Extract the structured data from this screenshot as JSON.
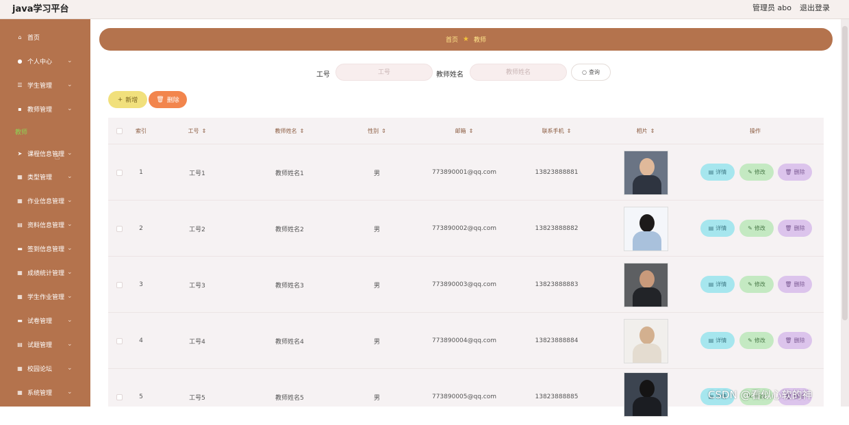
{
  "header": {
    "brand": "java学习平台",
    "admin": "管理员 abo",
    "logout": "退出登录"
  },
  "sidebar": {
    "items": [
      {
        "label": "首页",
        "icon": "home-icon",
        "has_chevron": false
      },
      {
        "label": "个人中心",
        "icon": "user-icon",
        "has_chevron": true
      },
      {
        "label": "学生管理",
        "icon": "list-icon",
        "has_chevron": true
      },
      {
        "label": "教师管理",
        "icon": "list-icon",
        "has_chevron": true
      }
    ],
    "group_label": "教师",
    "group_items": [
      {
        "label": "课程信息管理",
        "icon": "send-icon"
      },
      {
        "label": "类型管理",
        "icon": "grid-icon"
      },
      {
        "label": "作业信息管理",
        "icon": "grid-icon"
      },
      {
        "label": "资料信息管理",
        "icon": "doc-icon"
      },
      {
        "label": "签到信息管理",
        "icon": "list-icon"
      },
      {
        "label": "成绩统计管理",
        "icon": "grid-icon"
      },
      {
        "label": "学生作业管理",
        "icon": "grid-icon"
      },
      {
        "label": "试卷管理",
        "icon": "doc-icon"
      },
      {
        "label": "试题管理",
        "icon": "doc-icon"
      },
      {
        "label": "校园论坛",
        "icon": "grid-icon"
      },
      {
        "label": "系统管理",
        "icon": "grid-icon"
      }
    ]
  },
  "breadcrumb": {
    "home": "首页",
    "current": "教师"
  },
  "search": {
    "id_label": "工号",
    "id_placeholder": "工号",
    "name_label": "教师姓名",
    "name_placeholder": "教师姓名",
    "query_label": "查询"
  },
  "toolbar": {
    "add_label": "新增",
    "delete_label": "删除"
  },
  "table": {
    "columns": [
      "索引",
      "工号",
      "教师姓名",
      "性别",
      "邮箱",
      "联系手机",
      "相片",
      "操作"
    ],
    "actions": {
      "detail": "详情",
      "edit": "修改",
      "delete": "删除"
    },
    "rows": [
      {
        "index": "1",
        "id": "工号1",
        "name": "教师姓名1",
        "gender": "男",
        "email": "773890001@qq.com",
        "phone": "13823888881"
      },
      {
        "index": "2",
        "id": "工号2",
        "name": "教师姓名2",
        "gender": "男",
        "email": "773890002@qq.com",
        "phone": "13823888882"
      },
      {
        "index": "3",
        "id": "工号3",
        "name": "教师姓名3",
        "gender": "男",
        "email": "773890003@qq.com",
        "phone": "13823888883"
      },
      {
        "index": "4",
        "id": "工号4",
        "name": "教师姓名4",
        "gender": "男",
        "email": "773890004@qq.com",
        "phone": "13823888884"
      },
      {
        "index": "5",
        "id": "工号5",
        "name": "教师姓名5",
        "gender": "男",
        "email": "773890005@qq.com",
        "phone": "13823888885"
      }
    ]
  },
  "watermark": "CSDN @看似心软的神",
  "colors": {
    "sidebar": "#b4734d",
    "group": "#8ed454",
    "add": "#f1e07c",
    "delete": "#f2854d",
    "detail": "#a6e6ee",
    "edit": "#c4e9c2",
    "remove": "#dcc4ec"
  }
}
